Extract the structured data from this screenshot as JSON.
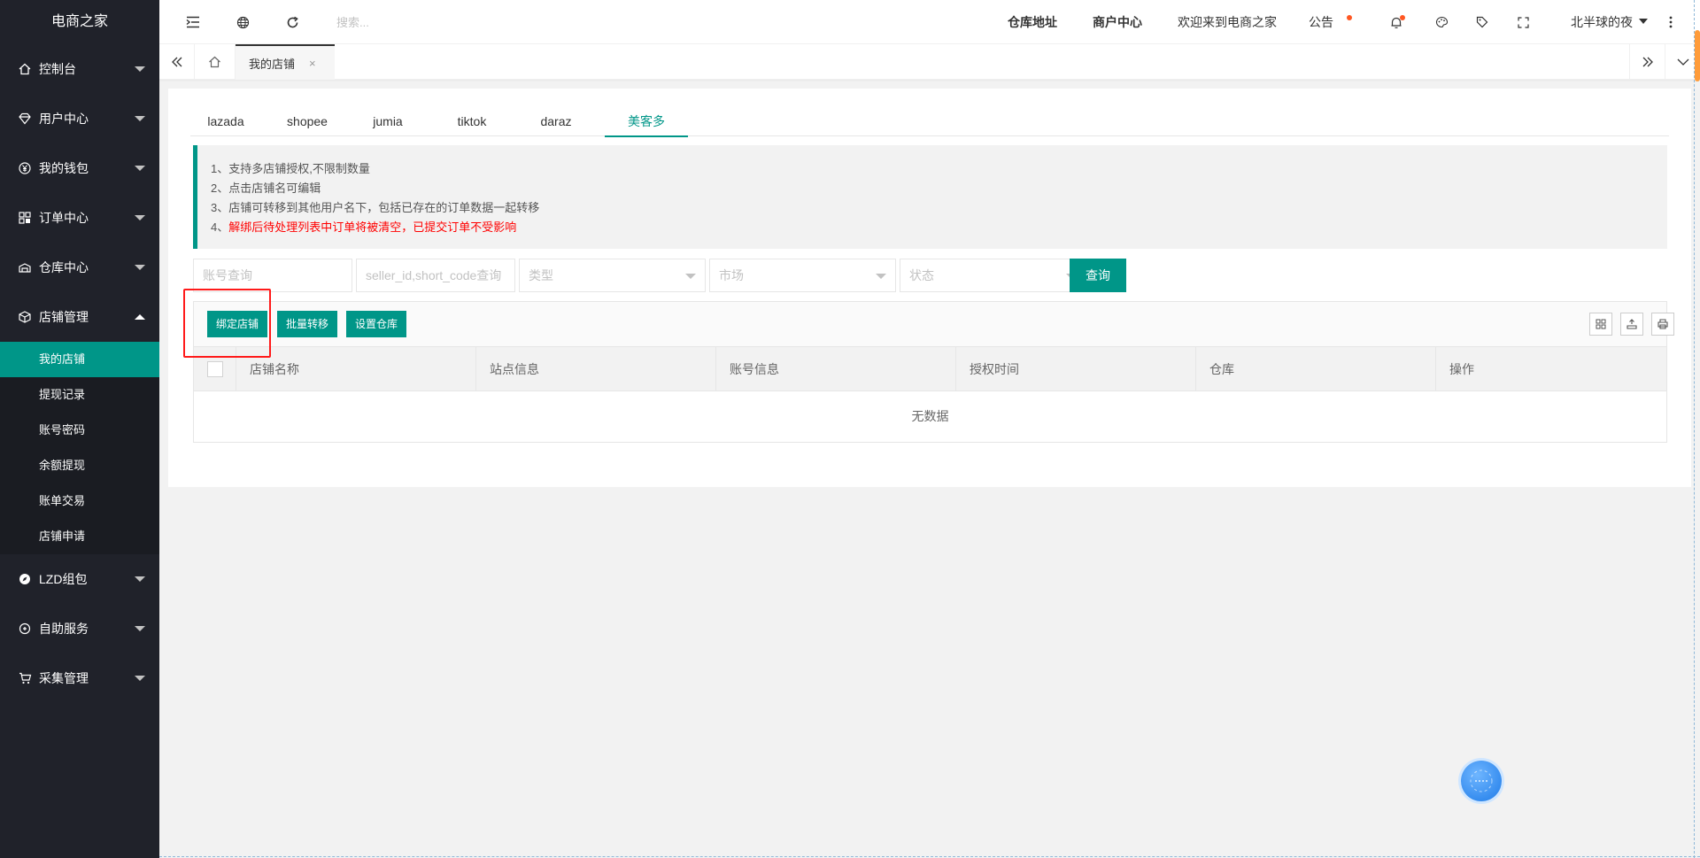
{
  "app": {
    "logo": "电商之家"
  },
  "sidebar": {
    "items": [
      {
        "label": "控制台",
        "icon": "home-icon"
      },
      {
        "label": "用户中心",
        "icon": "diamond-icon"
      },
      {
        "label": "我的钱包",
        "icon": "yen-icon"
      },
      {
        "label": "订单中心",
        "icon": "apps-icon"
      },
      {
        "label": "仓库中心",
        "icon": "warehouse-icon"
      },
      {
        "label": "店铺管理",
        "icon": "cube-icon",
        "expanded": true
      },
      {
        "label": "LZD组包",
        "icon": "compass-icon"
      },
      {
        "label": "自助服务",
        "icon": "service-icon"
      },
      {
        "label": "采集管理",
        "icon": "cart-icon"
      }
    ],
    "sub_items": [
      {
        "label": "我的店铺",
        "active": true
      },
      {
        "label": "提现记录"
      },
      {
        "label": "账号密码"
      },
      {
        "label": "余额提现"
      },
      {
        "label": "账单交易"
      },
      {
        "label": "店铺申请"
      }
    ]
  },
  "header": {
    "search_placeholder": "搜索...",
    "links": {
      "warehouse": "仓库地址",
      "merchant": "商户中心",
      "welcome": "欢迎来到电商之家",
      "notice": "公告",
      "user": "北半球的夜"
    }
  },
  "tabbar": {
    "tab_label": "我的店铺",
    "close": "×"
  },
  "platform_tabs": [
    "lazada",
    "shopee",
    "jumia",
    "tiktok",
    "daraz",
    "美客多"
  ],
  "active_platform": "美客多",
  "notice_lines": [
    "1、支持多店铺授权,不限制数量",
    "2、点击店铺名可编辑",
    "3、店铺可转移到其他用户名下，包括已存在的订单数据一起转移",
    "4、"
  ],
  "notice_warning": "解绑后待处理列表中订单将被清空，已提交订单不受影响",
  "filters": {
    "account_placeholder": "账号查询",
    "seller_placeholder": "seller_id,short_code查询",
    "type_placeholder": "类型",
    "market_placeholder": "市场",
    "status_placeholder": "状态",
    "query_button": "查询"
  },
  "toolbar": {
    "bind_store": "绑定店铺",
    "batch_transfer": "批量转移",
    "set_warehouse": "设置仓库"
  },
  "table": {
    "columns": [
      "店铺名称",
      "站点信息",
      "账号信息",
      "授权时间",
      "仓库",
      "操作"
    ],
    "empty_text": "无数据"
  },
  "colors": {
    "accent": "#009688",
    "sidebar": "#20222a",
    "highlight": "#ff1a1a",
    "warning": "#ff0000"
  }
}
